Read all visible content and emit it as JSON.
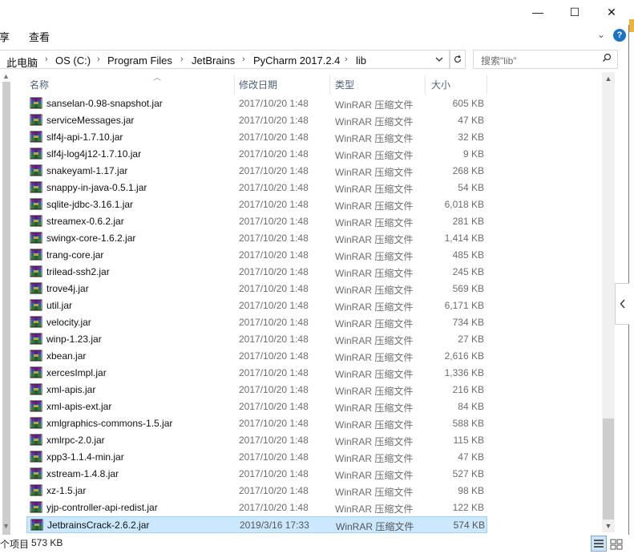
{
  "window": {
    "controls": {
      "minimize": "—",
      "maximize": "☐",
      "close": "✕"
    }
  },
  "ribbon": {
    "tabs": [
      "享",
      "查看"
    ],
    "expand_label": "⌄",
    "help_label": "?"
  },
  "address": {
    "crumbs": [
      "此电脑",
      "OS (C:)",
      "Program Files",
      "JetBrains",
      "PyCharm 2017.2.4",
      "lib"
    ],
    "separator": "›"
  },
  "search": {
    "placeholder": "搜索\"lib\""
  },
  "columns": {
    "name": "名称",
    "date": "修改日期",
    "type": "类型",
    "size": "大小"
  },
  "files": [
    {
      "name": "sanselan-0.98-snapshot.jar",
      "date": "2017/10/20 1:48",
      "type": "WinRAR 压缩文件",
      "size": "605 KB"
    },
    {
      "name": "serviceMessages.jar",
      "date": "2017/10/20 1:48",
      "type": "WinRAR 压缩文件",
      "size": "47 KB"
    },
    {
      "name": "slf4j-api-1.7.10.jar",
      "date": "2017/10/20 1:48",
      "type": "WinRAR 压缩文件",
      "size": "32 KB"
    },
    {
      "name": "slf4j-log4j12-1.7.10.jar",
      "date": "2017/10/20 1:48",
      "type": "WinRAR 压缩文件",
      "size": "9 KB"
    },
    {
      "name": "snakeyaml-1.17.jar",
      "date": "2017/10/20 1:48",
      "type": "WinRAR 压缩文件",
      "size": "268 KB"
    },
    {
      "name": "snappy-in-java-0.5.1.jar",
      "date": "2017/10/20 1:48",
      "type": "WinRAR 压缩文件",
      "size": "54 KB"
    },
    {
      "name": "sqlite-jdbc-3.16.1.jar",
      "date": "2017/10/20 1:48",
      "type": "WinRAR 压缩文件",
      "size": "6,018 KB"
    },
    {
      "name": "streamex-0.6.2.jar",
      "date": "2017/10/20 1:48",
      "type": "WinRAR 压缩文件",
      "size": "281 KB"
    },
    {
      "name": "swingx-core-1.6.2.jar",
      "date": "2017/10/20 1:48",
      "type": "WinRAR 压缩文件",
      "size": "1,414 KB"
    },
    {
      "name": "trang-core.jar",
      "date": "2017/10/20 1:48",
      "type": "WinRAR 压缩文件",
      "size": "485 KB"
    },
    {
      "name": "trilead-ssh2.jar",
      "date": "2017/10/20 1:48",
      "type": "WinRAR 压缩文件",
      "size": "245 KB"
    },
    {
      "name": "trove4j.jar",
      "date": "2017/10/20 1:48",
      "type": "WinRAR 压缩文件",
      "size": "569 KB"
    },
    {
      "name": "util.jar",
      "date": "2017/10/20 1:48",
      "type": "WinRAR 压缩文件",
      "size": "6,171 KB"
    },
    {
      "name": "velocity.jar",
      "date": "2017/10/20 1:48",
      "type": "WinRAR 压缩文件",
      "size": "734 KB"
    },
    {
      "name": "winp-1.23.jar",
      "date": "2017/10/20 1:48",
      "type": "WinRAR 压缩文件",
      "size": "27 KB"
    },
    {
      "name": "xbean.jar",
      "date": "2017/10/20 1:48",
      "type": "WinRAR 压缩文件",
      "size": "2,616 KB"
    },
    {
      "name": "xercesImpl.jar",
      "date": "2017/10/20 1:48",
      "type": "WinRAR 压缩文件",
      "size": "1,336 KB"
    },
    {
      "name": "xml-apis.jar",
      "date": "2017/10/20 1:48",
      "type": "WinRAR 压缩文件",
      "size": "216 KB"
    },
    {
      "name": "xml-apis-ext.jar",
      "date": "2017/10/20 1:48",
      "type": "WinRAR 压缩文件",
      "size": "84 KB"
    },
    {
      "name": "xmlgraphics-commons-1.5.jar",
      "date": "2017/10/20 1:48",
      "type": "WinRAR 压缩文件",
      "size": "588 KB"
    },
    {
      "name": "xmlrpc-2.0.jar",
      "date": "2017/10/20 1:48",
      "type": "WinRAR 压缩文件",
      "size": "115 KB"
    },
    {
      "name": "xpp3-1.1.4-min.jar",
      "date": "2017/10/20 1:48",
      "type": "WinRAR 压缩文件",
      "size": "47 KB"
    },
    {
      "name": "xstream-1.4.8.jar",
      "date": "2017/10/20 1:48",
      "type": "WinRAR 压缩文件",
      "size": "527 KB"
    },
    {
      "name": "xz-1.5.jar",
      "date": "2017/10/20 1:48",
      "type": "WinRAR 压缩文件",
      "size": "98 KB"
    },
    {
      "name": "yjp-controller-api-redist.jar",
      "date": "2017/10/20 1:48",
      "type": "WinRAR 压缩文件",
      "size": "122 KB"
    },
    {
      "name": "JetbrainsCrack-2.6.2.jar",
      "date": "2019/3/16 17:33",
      "type": "WinRAR 压缩文件",
      "size": "574 KB",
      "selected": true
    }
  ],
  "status": {
    "count": "个项目",
    "selected_size": "573 KB"
  },
  "icons": {
    "file": "winrar-archive-icon",
    "search": "search-icon",
    "refresh": "refresh-icon"
  }
}
